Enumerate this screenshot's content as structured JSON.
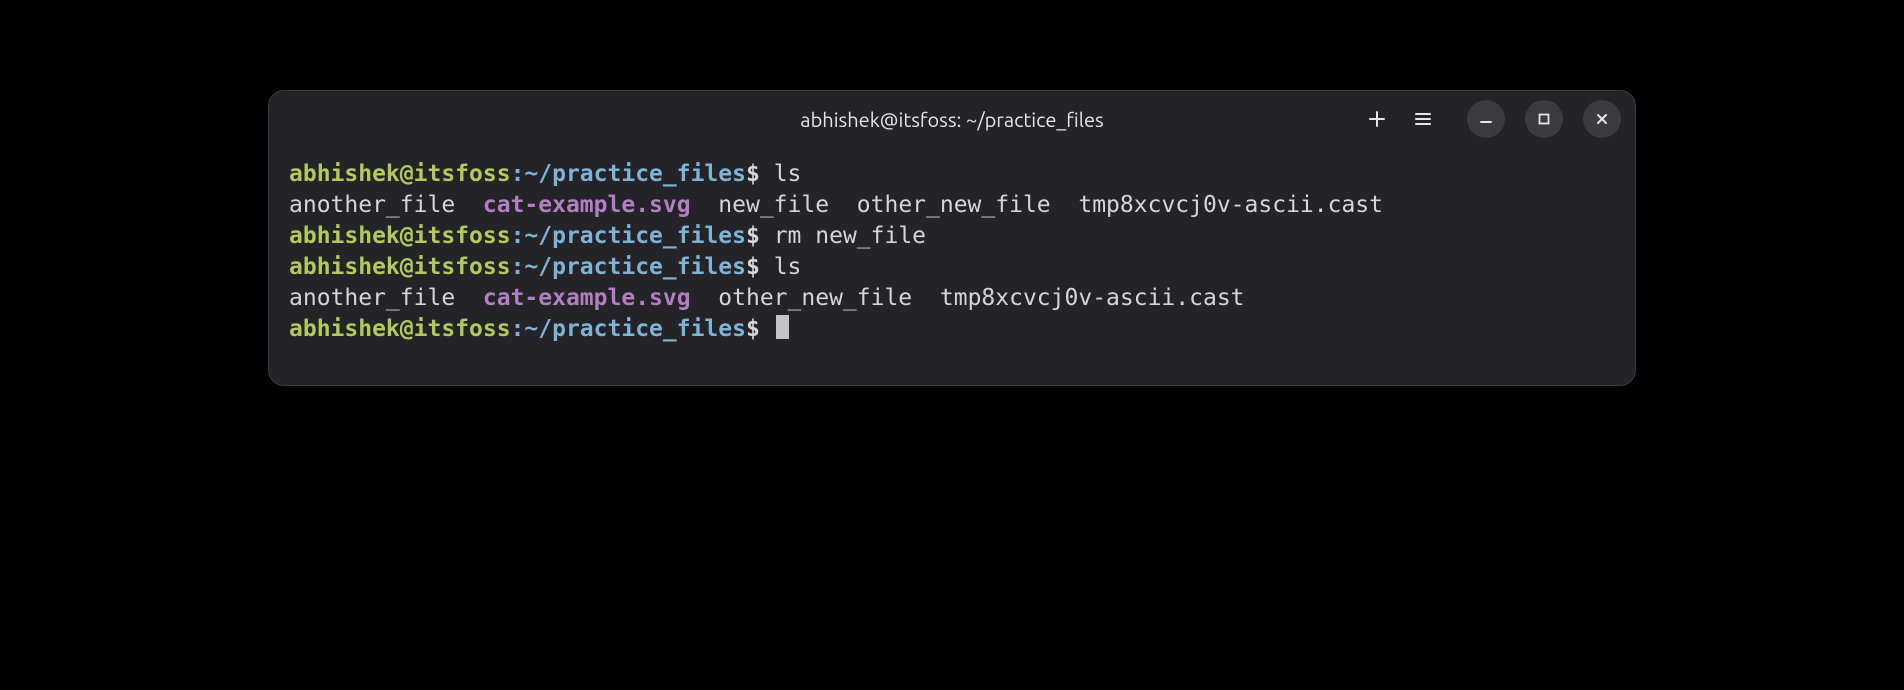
{
  "window": {
    "title": "abhishek@itsfoss: ~/practice_files"
  },
  "prompt": {
    "userhost": "abhishek@itsfoss",
    "sep": ":",
    "path": "~/practice_files",
    "dollar": "$"
  },
  "commands": {
    "ls1": "ls",
    "rm": "rm new_file",
    "ls2": "ls"
  },
  "output": {
    "ls1": {
      "f1": "another_file",
      "f2": "cat-example.svg",
      "f3": "new_file",
      "f4": "other_new_file",
      "f5": "tmp8xcvcj0v-ascii.cast"
    },
    "ls2": {
      "f1": "another_file",
      "f2": "cat-example.svg",
      "f3": "other_new_file",
      "f4": "tmp8xcvcj0v-ascii.cast"
    }
  }
}
